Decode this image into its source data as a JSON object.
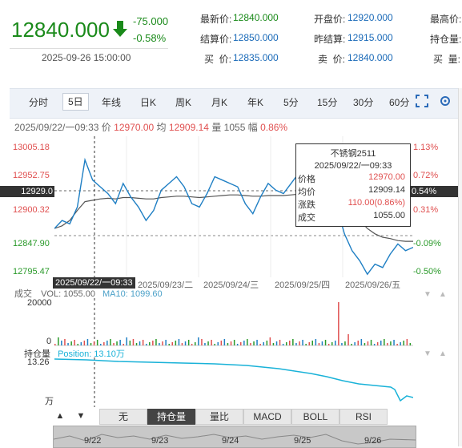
{
  "quote": {
    "price": "12840.000",
    "change": "-75.000",
    "change_pct": "-0.58%",
    "timestamp": "2025-09-26 15:00:00"
  },
  "fields": {
    "latest_label": "最新价:",
    "latest_value": "12840.000",
    "open_label": "开盘价:",
    "open_value": "12920.000",
    "high_label": "最高价:",
    "settle_label": "结算价:",
    "settle_value": "12850.000",
    "prev_settle_label": "昨结算:",
    "prev_settle_value": "12915.000",
    "oi_label": "持仓量:",
    "buy_label": "买  价:",
    "buy_value": "12835.000",
    "sell_label": "卖  价:",
    "sell_value": "12840.000",
    "buy_vol_label": "买  量:"
  },
  "tabs": [
    "分时",
    "5日",
    "年线",
    "日K",
    "周K",
    "月K",
    "年K",
    "5分",
    "15分",
    "30分",
    "60分"
  ],
  "active_tab": "5日",
  "info_line": {
    "datetime": "2025/09/22/一09:33",
    "price_label": "价",
    "price": "12970.00",
    "avg_label": "均",
    "avg": "12909.14",
    "vol_label": "量",
    "vol": "1055",
    "amp_label": "幅",
    "amp": "0.86%"
  },
  "y_left": [
    "13005.18",
    "12952.75",
    "12929.0",
    "12900.32",
    "12847.90",
    "12795.47"
  ],
  "y_right": [
    "1.13%",
    "0.72%",
    "0.54%",
    "0.31%",
    "-0.09%",
    "-0.50%"
  ],
  "x_labels": [
    "2025/09/22/一09:33",
    "2025/09/23/二",
    "2025/09/24/三",
    "2025/09/25/四",
    "2025/09/26/五"
  ],
  "tooltip": {
    "name": "不锈钢2511",
    "date": "2025/09/22/一09:33",
    "rows": [
      {
        "k": "价格",
        "v": "12970.00",
        "color": "#e05050"
      },
      {
        "k": "均价",
        "v": "12909.14",
        "color": "#333333"
      },
      {
        "k": "涨跌",
        "v": "110.00(0.86%)",
        "color": "#e05050"
      },
      {
        "k": "成交",
        "v": "1055.00",
        "color": "#333333"
      }
    ]
  },
  "volume": {
    "label": "成交",
    "vol_text": "VOL: 1055.00",
    "ma_text": "MA10: 1099.60",
    "y_top": "20000",
    "y_bottom": "0"
  },
  "position": {
    "label": "持仓量",
    "value_text": "Position: 13.10万",
    "y_top": "13.26",
    "unit": "万"
  },
  "bottom_buttons": [
    "无",
    "持仓量",
    "量比",
    "MACD",
    "BOLL",
    "RSI"
  ],
  "active_bottom": "持仓量",
  "scroller_labels": [
    "9/22",
    "9/23",
    "9/24",
    "9/25",
    "9/26"
  ],
  "colors": {
    "up": "#e05050",
    "down": "#1a8a1a",
    "price_line": "#1f7fc4",
    "avg_line": "#555555",
    "position_line": "#19b2d8"
  },
  "chart_data": {
    "type": "line",
    "series": [
      {
        "name": "价格",
        "values": [
          12868,
          12880,
          12875,
          12900,
          12970,
          12940,
          12930,
          12920,
          12905,
          12935,
          12915,
          12900,
          12880,
          12895,
          12925,
          12935,
          12945,
          12930,
          12905,
          12900,
          12920,
          12945,
          12940,
          12935,
          12930,
          12905,
          12890,
          12915,
          12935,
          12925,
          12920,
          12935,
          12950,
          12945,
          12940,
          12950,
          12930,
          12900,
          12860,
          12835,
          12820,
          12800,
          12815,
          12810,
          12830,
          12845,
          12835,
          12840
        ]
      },
      {
        "name": "均价",
        "values": [
          12868,
          12872,
          12880,
          12895,
          12908,
          12910,
          12912,
          12913,
          12912,
          12914,
          12914,
          12913,
          12912,
          12912,
          12914,
          12915,
          12916,
          12916,
          12915,
          12914,
          12915,
          12916,
          12917,
          12918,
          12918,
          12917,
          12916,
          12916,
          12917,
          12917,
          12917,
          12918,
          12919,
          12920,
          12921,
          12921,
          12920,
          12915,
          12905,
          12895,
          12880,
          12868,
          12860,
          12855,
          12853,
          12850,
          12849,
          12849
        ]
      }
    ],
    "ylim": [
      12795.47,
      13005.18
    ]
  }
}
